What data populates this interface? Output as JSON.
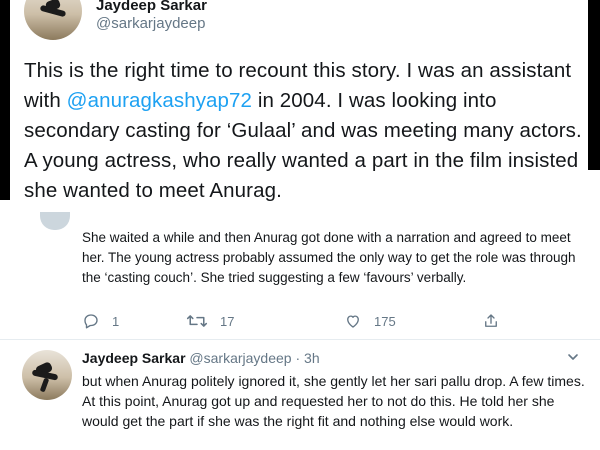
{
  "top_tweet": {
    "author_name": "Jaydeep Sarkar",
    "author_handle": "@sarkarjaydeep",
    "text_part1": "This is the right time to recount this story. I was an assistant with ",
    "mention": "@anuragkashyap72",
    "text_part2": " in 2004. I was looking into secondary casting for ‘Gulaal’ and was meeting many actors. A young actress, who really wanted a part in the film insisted she wanted to meet Anurag."
  },
  "reply1": {
    "text": "She waited a while and then Anurag got done with a narration and agreed to meet her. The young actress probably assumed the only way to get the role was through the ‘casting couch’. She tried suggesting a few ‘favours’ verbally.",
    "actions": {
      "reply_count": "1",
      "retweet_count": "17",
      "like_count": "175"
    },
    "icons": [
      "reply-icon",
      "retweet-icon",
      "like-icon",
      "share-icon"
    ]
  },
  "reply2": {
    "author_name": "Jaydeep Sarkar",
    "author_handle": "@sarkarjaydeep",
    "separator": "·",
    "time": "3h",
    "text": "but when Anurag politely ignored it, she gently let her sari pallu drop. A few times. At this point, Anurag got up and requested her to not do this. He told her she would get the part if she was the right fit and nothing else would work."
  },
  "colors": {
    "link": "#1da1f2",
    "text": "#14171a",
    "secondary": "#657786",
    "divider": "#e6ecf0"
  }
}
